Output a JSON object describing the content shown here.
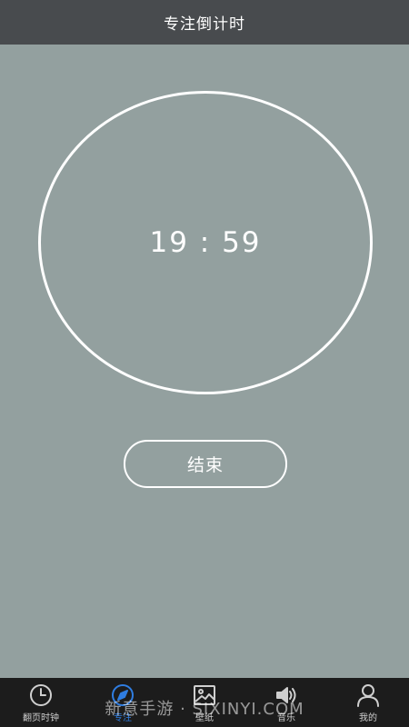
{
  "header": {
    "title": "专注倒计时"
  },
  "timer": {
    "display": "19 : 59"
  },
  "actions": {
    "end_label": "结束"
  },
  "tabbar": {
    "items": [
      {
        "label": "翻页时钟",
        "icon": "clock-icon",
        "active": false
      },
      {
        "label": "专注",
        "icon": "compass-icon",
        "active": true
      },
      {
        "label": "壁纸",
        "icon": "image-icon",
        "active": false
      },
      {
        "label": "音乐",
        "icon": "speaker-icon",
        "active": false
      },
      {
        "label": "我的",
        "icon": "user-icon",
        "active": false
      }
    ]
  },
  "watermark": {
    "text": "新意手游 · SIXINYI.COM"
  },
  "colors": {
    "background": "#93a09f",
    "title_bar": "#484b4e",
    "tab_bar": "#1c1c1c",
    "active_tab": "#2f7de1",
    "ring": "#ffffff"
  }
}
